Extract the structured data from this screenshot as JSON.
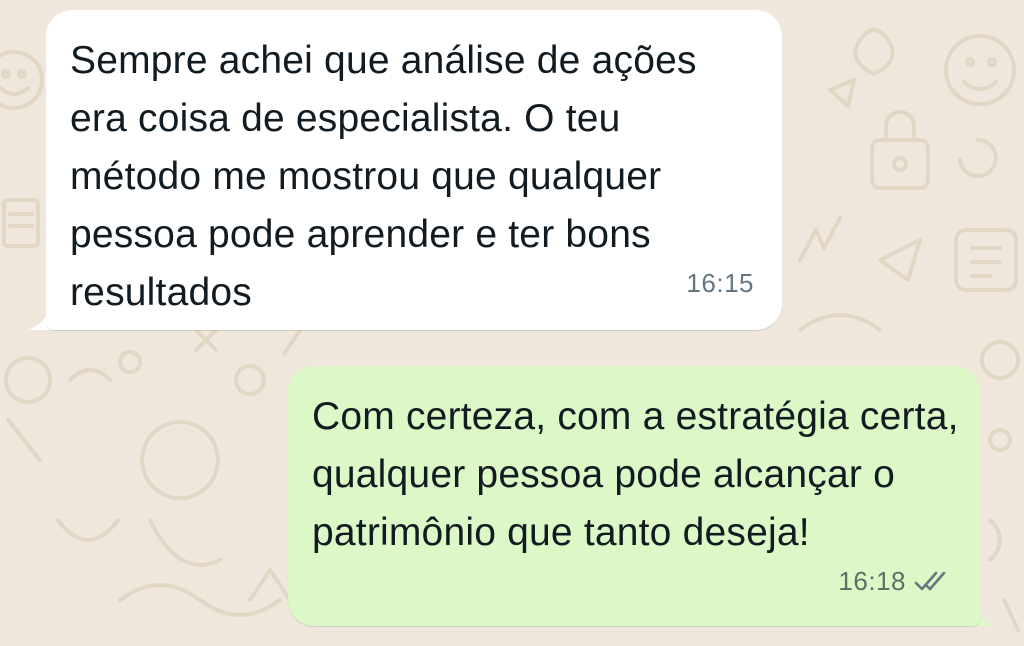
{
  "chat": {
    "messages": [
      {
        "direction": "incoming",
        "text": "Sempre achei que análise de ações era coisa de especialista. O teu método me mostrou que qualquer pessoa pode aprender e ter bons resultados",
        "time": "16:15"
      },
      {
        "direction": "outgoing",
        "text": "Com certeza, com a estratégia certa, qualquer pessoa pode alcançar o patrimônio que tanto deseja!",
        "time": "16:18",
        "status_icon": "double-check-icon"
      }
    ]
  },
  "colors": {
    "background": "#efe7db",
    "wallpaper_doodle": "#e2d7c4",
    "incoming_bubble": "#ffffff",
    "outgoing_bubble": "#dcf8c6",
    "text": "#111b21",
    "meta_text": "#667781"
  }
}
